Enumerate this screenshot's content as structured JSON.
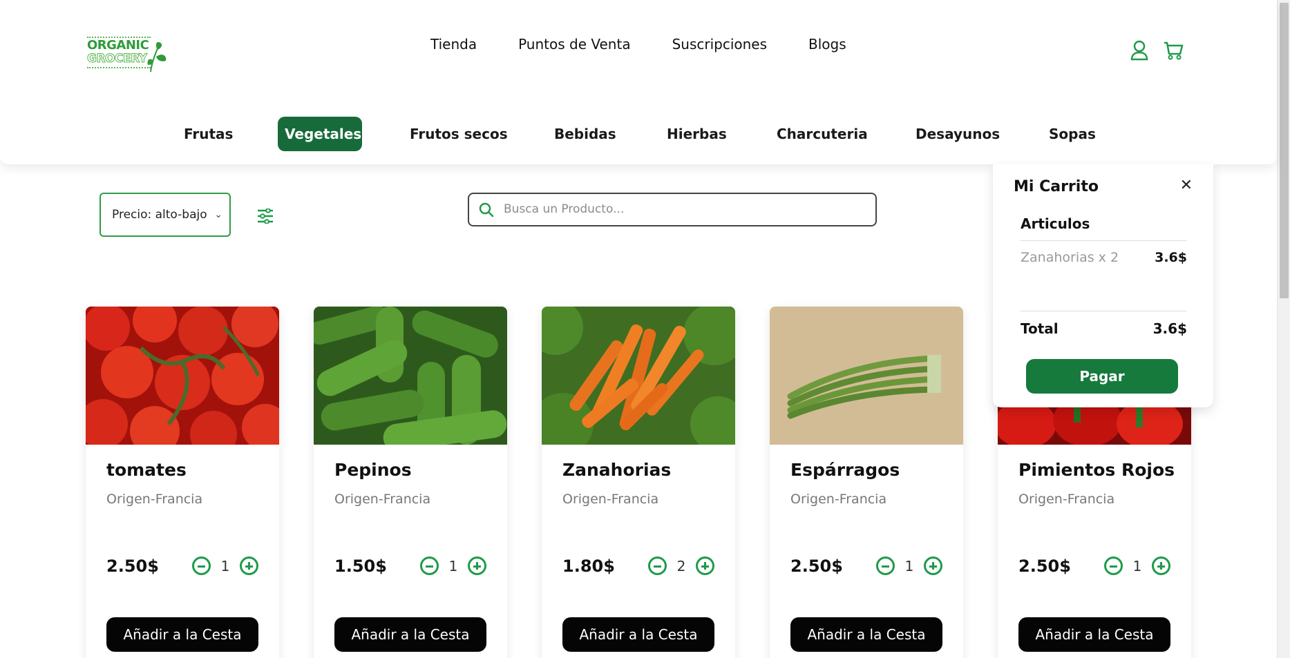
{
  "brand": {
    "line1": "ORGANIC",
    "line2": "GROCERY",
    "color": "#2f9b3a"
  },
  "top_nav": [
    "Tienda",
    "Puntos de Venta",
    "Suscripciones",
    "Blogs"
  ],
  "header_icons": [
    "user-icon",
    "cart-icon"
  ],
  "categories": {
    "items": [
      "Frutas",
      "Vegetales",
      "Frutos secos",
      "Bebidas",
      "Hierbas",
      "Charcuteria",
      "Desayunos",
      "Sopas"
    ],
    "active": "Vegetales",
    "active_color": "#176b3a"
  },
  "filters": {
    "sort_selected": "Precio: alto-bajo",
    "search_placeholder": "Busca un Producto..."
  },
  "products": [
    {
      "name": "tomates",
      "origin": "Origen-Francia",
      "price": "2.50$",
      "qty": "1",
      "button": "Añadir a la Cesta"
    },
    {
      "name": "Pepinos",
      "origin": "Origen-Francia",
      "price": "1.50$",
      "qty": "1",
      "button": "Añadir a la Cesta"
    },
    {
      "name": "Zanahorias",
      "origin": "Origen-Francia",
      "price": "1.80$",
      "qty": "2",
      "button": "Añadir a la Cesta"
    },
    {
      "name": "Espárragos",
      "origin": "Origen-Francia",
      "price": "2.50$",
      "qty": "1",
      "button": "Añadir a la Cesta"
    },
    {
      "name": "Pimientos Rojos",
      "origin": "Origen-Francia",
      "price": "2.50$",
      "qty": "1",
      "button": "Añadir a la Cesta"
    }
  ],
  "cart": {
    "title": "Mi Carrito",
    "section": "Articulos",
    "items": [
      {
        "label": "Zanahorias x 2",
        "price": "3.6$"
      }
    ],
    "total_label": "Total",
    "total_value": "3.6$",
    "pay_label": "Pagar"
  },
  "colors": {
    "accent": "#1e9a49",
    "dark_green": "#167a3d",
    "button_black": "#050505"
  }
}
